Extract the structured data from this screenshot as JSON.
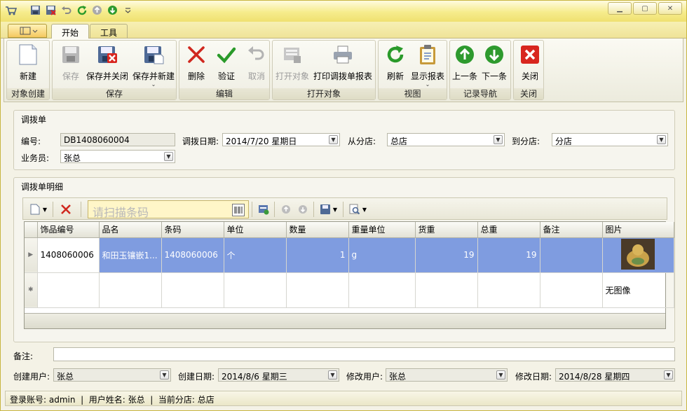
{
  "tabs": {
    "start": "开始",
    "tools": "工具"
  },
  "ribbon": {
    "groups": [
      "对象创建",
      "保存",
      "编辑",
      "打开对象",
      "视图",
      "记录导航",
      "关闭"
    ],
    "buttons": {
      "new": "新建",
      "save": "保存",
      "save_close": "保存并关闭",
      "save_new": "保存并新建",
      "delete": "删除",
      "validate": "验证",
      "cancel": "取消",
      "open_object": "打开对象",
      "print_report": "打印调拨单报表",
      "refresh": "刷新",
      "show_report": "显示报表",
      "prev": "上一条",
      "next": "下一条",
      "close": "关闭"
    }
  },
  "form": {
    "title": "调拨单",
    "number_label": "编号:",
    "number_value": "DB1408060004",
    "date_label": "调拨日期:",
    "date_value": "2014/7/20 星期日",
    "from_label": "从分店:",
    "from_value": "总店",
    "to_label": "到分店:",
    "to_value": "分店",
    "salesman_label": "业务员:",
    "salesman_value": "张总"
  },
  "detail": {
    "title": "调拨单明细",
    "scan_placeholder": "请扫描条码",
    "columns": [
      "饰品编号",
      "品名",
      "条码",
      "单位",
      "数量",
      "重量单位",
      "货重",
      "总重",
      "备注",
      "图片"
    ],
    "rows": [
      {
        "code": "1408060006",
        "name": "和田玉镶嵌1...",
        "barcode": "1408060006",
        "unit": "个",
        "qty": "1",
        "weight_unit": "g",
        "goods_weight": "19",
        "total_weight": "19",
        "note": ""
      }
    ],
    "new_row_image_text": "无图像"
  },
  "footer": {
    "note_label": "备注:",
    "note_value": "",
    "creator_label": "创建用户:",
    "creator_value": "张总",
    "created_label": "创建日期:",
    "created_value": "2014/8/6 星期三",
    "modifier_label": "修改用户:",
    "modifier_value": "张总",
    "modified_label": "修改日期:",
    "modified_value": "2014/8/28 星期四"
  },
  "status": {
    "text": "登录账号: admin  |  用户姓名: 张总  |  当前分店: 总店"
  },
  "colors": {
    "selected_row": "#7f9ce0",
    "titlebar": "#f6ec8c"
  }
}
